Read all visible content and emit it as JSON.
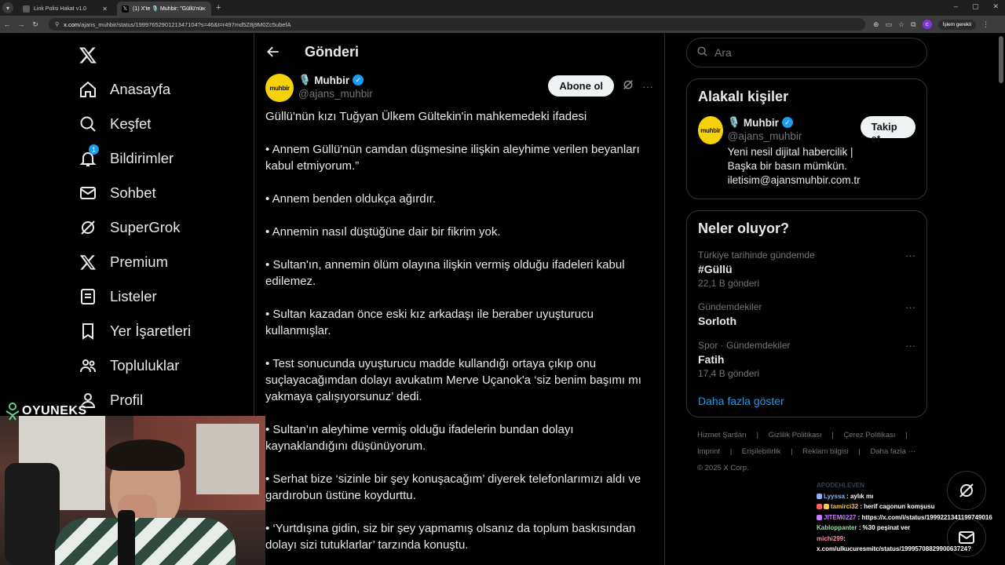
{
  "browser": {
    "tabs": [
      {
        "title": "Link Polisi Hakat v1.0"
      },
      {
        "title": "(1) X'te 🎙️ Muhbir: \"Güllü'nün ..."
      }
    ],
    "url_host": "x.com",
    "url_path": "/ajans_muhbir/status/1999765290121347104?s=46&t=r497md5Z8j9M0Zc5ubefA",
    "profile_initial": "c",
    "action_label": "İşlem gerekli"
  },
  "nav": {
    "items": [
      {
        "label": "Anasayfa",
        "icon": "home-icon"
      },
      {
        "label": "Keşfet",
        "icon": "search-icon"
      },
      {
        "label": "Bildirimler",
        "icon": "bell-icon",
        "badge": "1"
      },
      {
        "label": "Sohbet",
        "icon": "mail-icon"
      },
      {
        "label": "SuperGrok",
        "icon": "grok-icon"
      },
      {
        "label": "Premium",
        "icon": "x-icon"
      },
      {
        "label": "Listeler",
        "icon": "list-icon"
      },
      {
        "label": "Yer İşaretleri",
        "icon": "bookmark-icon"
      },
      {
        "label": "Topluluklar",
        "icon": "people-icon"
      },
      {
        "label": "Profil",
        "icon": "person-icon"
      }
    ]
  },
  "post": {
    "header_title": "Gönderi",
    "author_name": "Muhbir",
    "author_handle": "@ajans_muhbir",
    "avatar_text": "muhbir",
    "subscribe_label": "Abone ol",
    "paragraphs": [
      "Güllü'nün kızı Tuğyan Ülkem Gültekin'in mahkemedeki ifadesi",
      "• Annem Güllü'nün camdan düşmesine ilişkin aleyhime verilen beyanları kabul etmiyorum.”",
      "• Annem benden oldukça ağırdır.",
      "• Annemin nasıl düştüğüne dair bir fikrim yok.",
      "• Sultan'ın, annemin ölüm olayına ilişkin vermiş olduğu ifadeleri kabul edilemez.",
      "• Sultan kazadan önce eski kız arkadaşı ile beraber uyuşturucu kullanmışlar.",
      "• Test sonucunda uyuşturucu madde kullandığı ortaya çıkıp onu suçlayacağımdan dolayı avukatım Merve Uçanok'a ‘siz benim başımı mı yakmaya çalışıyorsunuz’ dedi.",
      "• Sultan'ın aleyhime vermiş olduğu ifadelerin bundan dolayı kaynaklandığını düşünüyorum.",
      "• Serhat bize ‘sizinle bir şey konuşacağım’ diyerek telefonlarımızı aldı ve gardırobun üstüne koydurttu.",
      "• ‘Yurtdışına gidin, siz bir şey yapmamış olsanız da toplum baskısından dolayı sizi tutuklarlar’ tarzında konuştu."
    ]
  },
  "right": {
    "search_placeholder": "Ara",
    "related_title": "Alakalı kişiler",
    "related": {
      "name": "Muhbir",
      "handle": "@ajans_muhbir",
      "bio": "Yeni nesil dijital habercilik | Başka bir basın mümkün. iletisim@ajansmuhbir.com.tr",
      "follow_label": "Takip et",
      "avatar_text": "muhbir"
    },
    "trends_title": "Neler oluyor?",
    "trends": [
      {
        "context": "Türkiye tarihinde gündemde",
        "name": "#Güllü",
        "count": "22,1 B gönderi"
      },
      {
        "context": "Gündemdekiler",
        "name": "Sorloth",
        "count": ""
      },
      {
        "context": "Spor · Gündemdekiler",
        "name": "Fatih",
        "count": "17,4 B gönderi"
      }
    ],
    "show_more": "Daha fazla göster",
    "footer_row1": [
      "Hizmet Şartları",
      "|",
      "Gizlilik Politikası",
      "|",
      "Çerez Politikası",
      "|"
    ],
    "footer_row2": [
      "Imprint",
      "|",
      "Erişilebilirlik",
      "|",
      "Reklam bilgisi",
      "|",
      "Daha fazla ···"
    ],
    "footer_row3": [
      "© 2025 X Corp."
    ]
  },
  "overlay": {
    "brand": "OYUNEKS",
    "chat": [
      {
        "user": "APODEHLEVEN",
        "msg": "",
        "faded": true
      },
      {
        "user": "Lyyssa",
        "msg": ": aylık mı"
      },
      {
        "user": "tamirci32",
        "msg": ": herif cagonun komşusu"
      },
      {
        "user": "JITEM0227",
        "msg": ": https://x.com/i/status/1999221341199749016"
      },
      {
        "user": "Kabloppanter",
        "msg": ": %30 peşinat ver"
      },
      {
        "user": "michi299",
        "msg": ":"
      },
      {
        "user": "",
        "msg": "x.com/ulkucuresmitc/status/1999570882990063724?"
      }
    ]
  },
  "colors": {
    "accent": "#1d9bf0",
    "background": "#000000",
    "border": "#2f3336",
    "muted": "#71767b",
    "muhbir_yellow": "#f5d20a"
  }
}
